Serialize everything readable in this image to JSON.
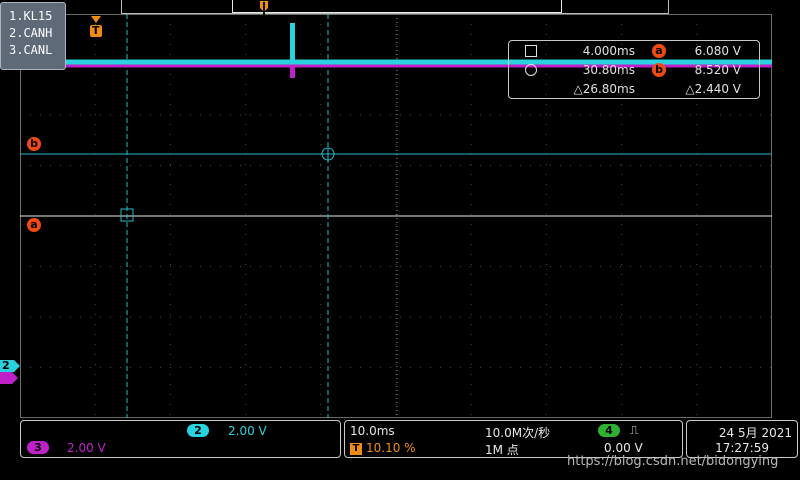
{
  "legend": {
    "items": [
      "1.KL15",
      "2.CANH",
      "3.CANL"
    ]
  },
  "markers": {
    "trigger_flag": "T",
    "cursor_a": "a",
    "cursor_b": "b",
    "ch2_marker": "2"
  },
  "measurement": {
    "row1_time": "4.000ms",
    "row1_ab": "a",
    "row1_volt": "6.080 V",
    "row2_time": "30.80ms",
    "row2_ab": "b",
    "row2_volt": "8.520 V",
    "row3_dtime": "△26.80ms",
    "row3_dvolt": "△2.440 V"
  },
  "channels": {
    "ch2_badge": "2",
    "ch2_scale": "2.00 V",
    "ch3_badge": "3",
    "ch3_scale": "2.00 V",
    "ch2_color": "#28d2de",
    "ch3_color": "#c020c8"
  },
  "timebase": {
    "scale": "10.0ms",
    "sample_rate": "10.0M次/秒",
    "trigger_flag": "T",
    "trigger_pos": "10.10 %",
    "record_length": "1M 点",
    "trigger_source_badge": "4",
    "trigger_slope": "⎍",
    "trigger_level": "0.00 V"
  },
  "datetime": {
    "date": "24 5月 2021",
    "time": "17:27:59"
  },
  "watermark": "https://blog.csdn.net/bidongying"
}
